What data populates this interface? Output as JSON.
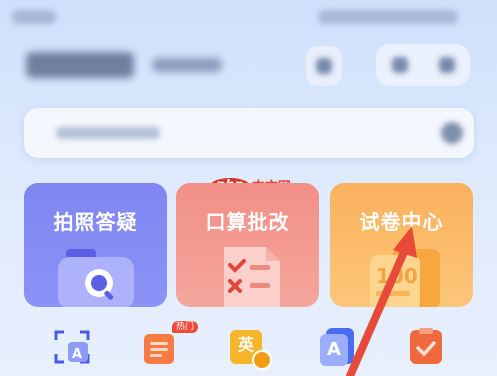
{
  "watermark": {
    "logo": "php",
    "text": "中文网"
  },
  "cards": [
    {
      "label": "拍照答疑",
      "icon": "photo-search-icon"
    },
    {
      "label": "口算批改",
      "icon": "checklist-icon"
    },
    {
      "label": "试卷中心",
      "icon": "exam-paper-icon"
    }
  ],
  "tools": [
    {
      "icon": "scan-a-icon"
    },
    {
      "icon": "document-icon",
      "badge": "热门"
    },
    {
      "icon": "english-icon",
      "glyph": "英"
    },
    {
      "icon": "font-a-icon",
      "glyph": "A"
    },
    {
      "icon": "clipboard-check-icon"
    }
  ],
  "annotation": {
    "icon": "red-arrow-icon",
    "target": "试卷中心"
  },
  "colors": {
    "photo_card": "#7f86f2",
    "calc_card": "#f28f86",
    "paper_card": "#fbb15c",
    "arrow": "#e84a3a",
    "badge": "#f04a3a"
  }
}
